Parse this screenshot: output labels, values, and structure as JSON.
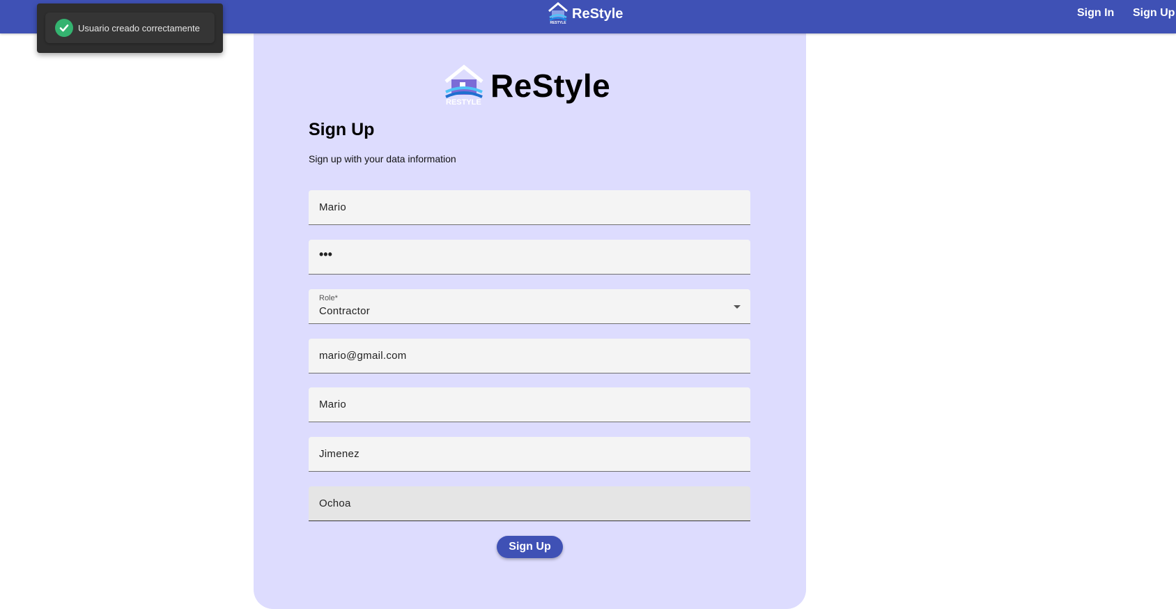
{
  "navbar": {
    "brand": "ReStyle",
    "links": [
      "Sign In",
      "Sign Up"
    ]
  },
  "toast": {
    "icon": "check-circle-icon",
    "message": "Usuario creado correctamente"
  },
  "logo": {
    "text": "ReStyle",
    "mark_text": "RESTYLE"
  },
  "form": {
    "title": "Sign Up",
    "subtitle": "Sign up with your data information",
    "fields": [
      {
        "value": "Mario"
      },
      {
        "value": "•••",
        "type": "password"
      },
      {
        "label": "Role*",
        "value": "Contractor",
        "type": "select"
      },
      {
        "value": "mario@gmail.com"
      },
      {
        "value": "Mario"
      },
      {
        "value": "Jimenez"
      },
      {
        "value": "Ochoa"
      }
    ],
    "submit_label": "Sign Up"
  },
  "colors": {
    "primary": "#3f51b5",
    "card_bg": "#dddcfe",
    "success": "#34b370"
  }
}
